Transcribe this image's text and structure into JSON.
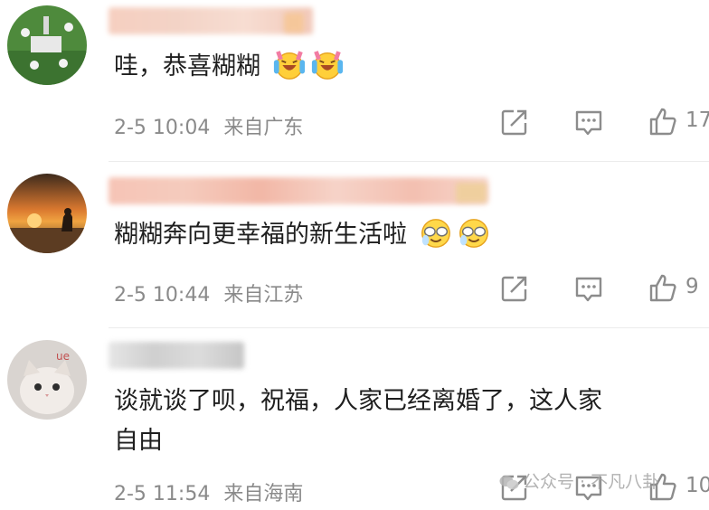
{
  "comments": [
    {
      "text": "哇，恭喜糊糊",
      "emoji": [
        "laugh-cry-emoji",
        "laugh-cry-emoji"
      ],
      "time": "2-5 10:04",
      "location": "来自广东",
      "likes": "17"
    },
    {
      "text": "糊糊奔向更幸福的新生活啦",
      "emoji": [
        "crying-laughing-emoji",
        "crying-laughing-emoji"
      ],
      "time": "2-5 10:44",
      "location": "来自江苏",
      "likes": "9"
    },
    {
      "text_line1": "谈就谈了呗，祝福，人家已经离婚了，这人家",
      "text_line2": "自由",
      "time": "2-5 11:54",
      "location": "来自海南",
      "likes": "10"
    }
  ],
  "watermark": "公众号 · 不凡八卦",
  "colors": {
    "meta": "#8a8a8a",
    "text": "#1f1f1f"
  }
}
